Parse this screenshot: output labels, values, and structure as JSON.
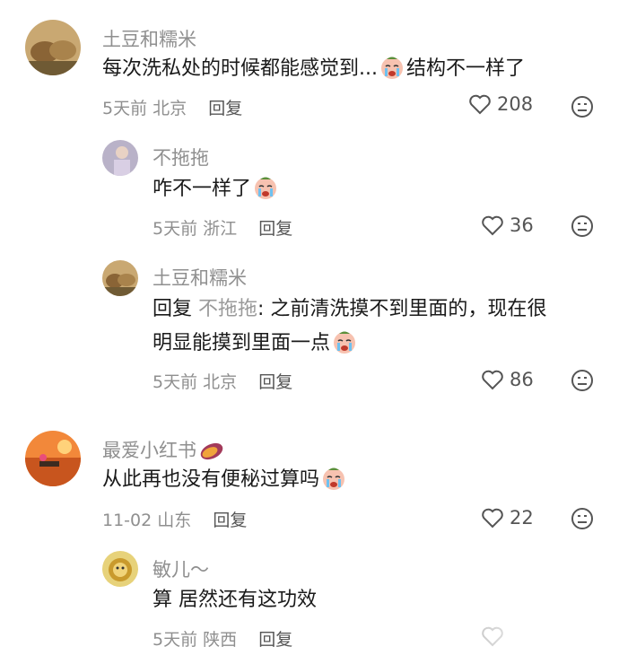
{
  "comments": [
    {
      "user": "土豆和糯米",
      "text_before": "每次洗私处的时候都能感觉到...",
      "text_after": "结构不一样了",
      "time": "5天前",
      "location": "北京",
      "reply_label": "回复",
      "likes": "208"
    },
    {
      "user": "不拖拖",
      "text_before": "咋不一样了",
      "time": "5天前",
      "location": "浙江",
      "reply_label": "回复",
      "likes": "36"
    },
    {
      "user": "土豆和糯米",
      "reply_prefix": "回复",
      "reply_target": "不拖拖",
      "line1": ": 之前清洗摸不到里面的，现在很",
      "line2": "明显能摸到里面一点",
      "time": "5天前",
      "location": "北京",
      "reply_label": "回复",
      "likes": "86"
    },
    {
      "user": "最爱小红书",
      "text_before": "从此再也没有便秘过算吗",
      "time": "11-02",
      "location": "山东",
      "reply_label": "回复",
      "likes": "22"
    },
    {
      "user": "敏儿～",
      "text_before": "算 居然还有这功效",
      "time": "5天前",
      "location": "陕西",
      "reply_label": "回复"
    }
  ],
  "icons": {
    "like": "heart-outline-icon",
    "dislike": "neutral-face-icon",
    "emoji_cry": "crying-face-emoji",
    "emoji_sweet_potato": "sweet-potato-emoji"
  },
  "colors": {
    "secondary_text": "#8f8f8f",
    "primary_text": "#1a1a1a"
  }
}
